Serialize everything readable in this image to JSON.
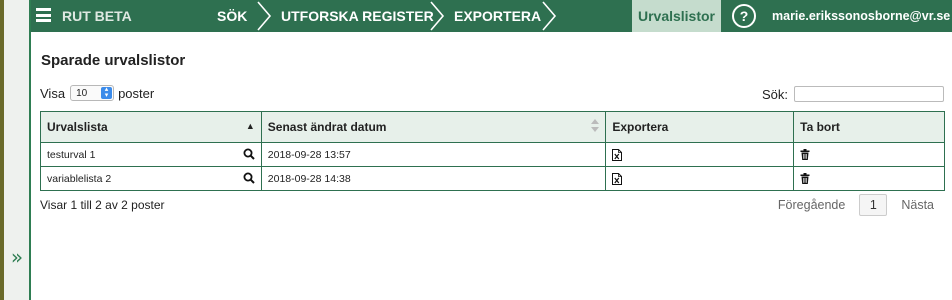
{
  "header": {
    "brand": "RUT BETA",
    "nav": [
      "SÖK",
      "UTFORSKA REGISTER",
      "EXPORTERA"
    ],
    "active_tab": "Urvalslistor",
    "help_label": "?",
    "user_email": "marie.erikssonosborne@vr.se",
    "accent_color": "#2e7050"
  },
  "page": {
    "title": "Sparade urvalslistor",
    "length": {
      "prefix": "Visa",
      "value": "10",
      "suffix": "poster"
    },
    "search": {
      "label": "Sök:",
      "value": ""
    }
  },
  "table": {
    "headers": [
      "Urvalslista",
      "Senast ändrat datum",
      "Exportera",
      "Ta bort"
    ],
    "rows": [
      {
        "name": "testurval 1",
        "date": "2018-09-28 13:57"
      },
      {
        "name": "variablelista 2",
        "date": "2018-09-28 14:38"
      }
    ]
  },
  "footer": {
    "info": "Visar 1 till 2 av 2 poster",
    "prev": "Föregående",
    "page": "1",
    "next": "Nästa"
  }
}
